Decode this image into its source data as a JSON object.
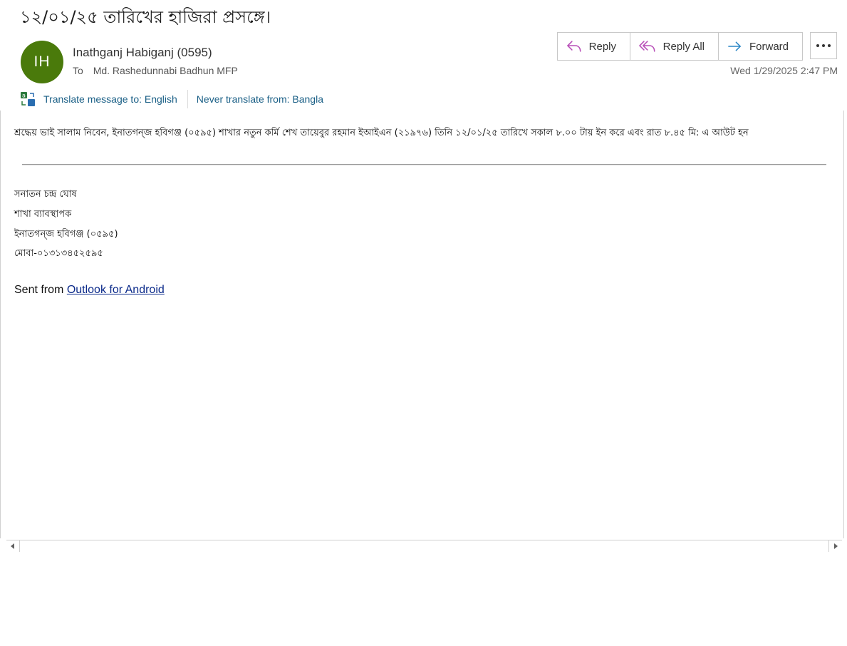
{
  "email": {
    "subject": "১২/০১/২৫ তারিখের হাজিরা প্রসঙ্গে।",
    "avatar_initials": "IH",
    "avatar_color": "#4a7a0b",
    "sender": "Inathganj Habiganj (0595)",
    "to_label": "To",
    "recipient": "Md. Rashedunnabi Badhun MFP",
    "date": "Wed 1/29/2025 2:47 PM"
  },
  "actions": {
    "reply": "Reply",
    "reply_all": "Reply All",
    "forward": "Forward",
    "more": "more-options-icon"
  },
  "translate": {
    "translate_to": "Translate message to: English",
    "never_translate": "Never translate from: Bangla"
  },
  "body": {
    "main_text": "শ্রদ্ধেয় ভাই  সালাম নিবেন, ইনাতগন্জ হবিগঞ্জ (০৫৯৫) শাখার নতুন কর্মি শেখ তায়েবুর রহমান  ইআইএন (২১৯৭৬) তিনি ১২/০১/২৫ তারিখে  সকাল ৮.০০ টায় ইন করে এবং রাত ৮.৪৫ মি: এ আউট হন",
    "signature": [
      "সনাতন চন্দ্র ঘোষ",
      "শাখা ব্যাবস্থাপক",
      "ইনাতগন্জ হবিগঞ্জ (০৫৯৫)",
      "মোবা-০১৩১৩৪৫২৫৯৫"
    ],
    "sent_from_prefix": "Sent from ",
    "sent_from_link": "Outlook for Android"
  },
  "colors": {
    "link": "#1a5f86",
    "action_icon_reply": "#b84fb8",
    "action_icon_forward": "#2a86c6"
  }
}
